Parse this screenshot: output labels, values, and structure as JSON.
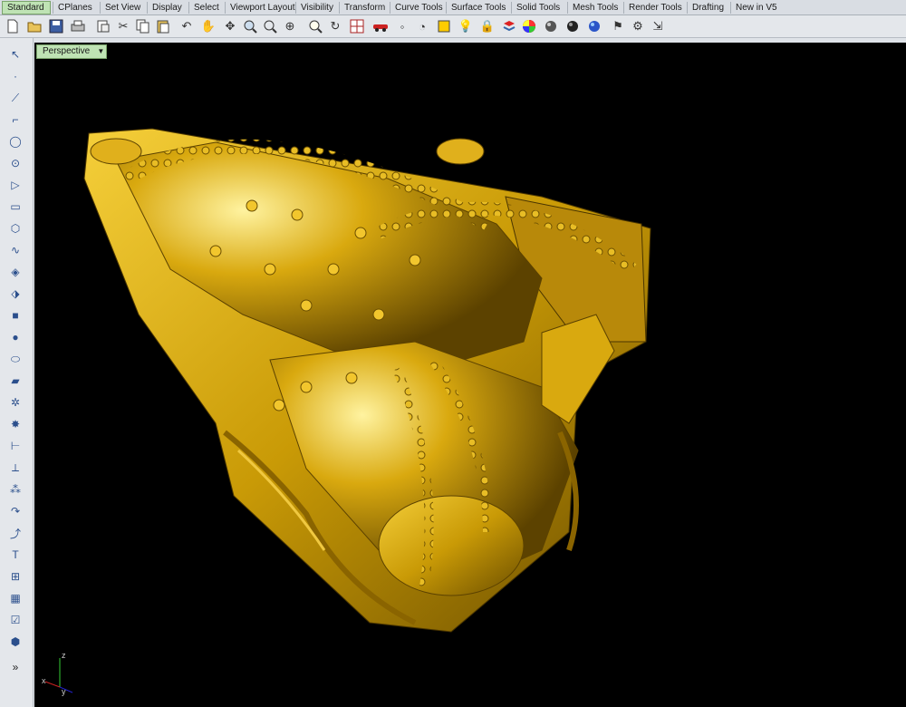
{
  "tabs": [
    "Standard",
    "CPlanes",
    "Set View",
    "Display",
    "Select",
    "Viewport Layout",
    "Visibility",
    "Transform",
    "Curve Tools",
    "Surface Tools",
    "Solid Tools",
    "Mesh Tools",
    "Render Tools",
    "Drafting",
    "New in V5"
  ],
  "active_tab": "Standard",
  "viewport": {
    "label": "Perspective"
  },
  "axis": {
    "x": "x",
    "y": "y",
    "z": "z"
  },
  "sidebar_more": "»",
  "colors": {
    "model_gold": "#c99a06",
    "viewport_bg": "#000000",
    "active_tab": "#bfe3b4"
  },
  "toolbar_icons": [
    "new-icon",
    "open-icon",
    "save-icon",
    "print-icon",
    "copy-to-clipboard-icon",
    "cut-icon",
    "copy-icon",
    "paste-icon",
    "undo-icon",
    "pan-icon",
    "move-icon",
    "zoom-icon",
    "zoom-window-icon",
    "zoom-extents-icon",
    "rotate-view-icon",
    "grid-icon",
    "car-icon",
    "dot-icon",
    "clock-icon",
    "snap-icon",
    "light-icon",
    "lock-icon",
    "layer-icon",
    "color-wheel-icon",
    "sphere-icon",
    "render-sphere-icon",
    "globe-icon",
    "flag-icon",
    "gear-icon",
    "arrow-icon"
  ],
  "sidebar_icons": [
    "select-arrow-icon",
    "point-icon",
    "polyline-icon",
    "curve-icon",
    "circle-icon",
    "ellipse-icon",
    "arc-icon",
    "rectangle-icon",
    "polygon-icon",
    "spline-icon",
    "surface-icon",
    "extrude-icon",
    "box-icon",
    "boolean-icon",
    "cylinder-icon",
    "mesh-icon",
    "gear-tools-icon",
    "explode-icon",
    "trim-icon",
    "fillet-icon",
    "dots-icon",
    "curve-arrow-icon",
    "blend-icon",
    "text-icon",
    "dimension-icon",
    "array-icon",
    "check-icon",
    "cube-icon"
  ]
}
